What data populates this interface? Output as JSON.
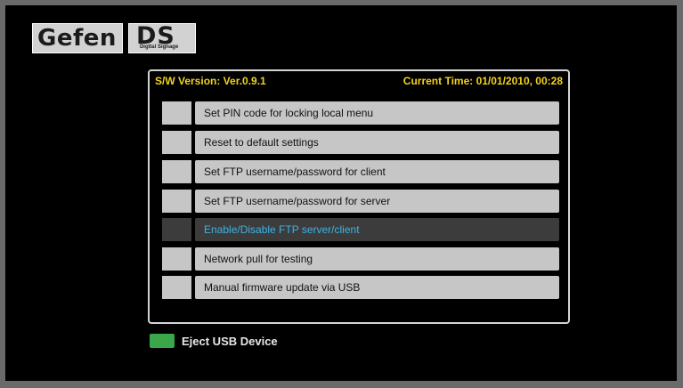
{
  "brand": {
    "name": "Gefen",
    "product": "DS",
    "product_subtitle": "Digital Signage"
  },
  "header": {
    "version": "S/W Version: Ver.0.9.1",
    "current_time": "Current Time: 01/01/2010, 00:28"
  },
  "menu": {
    "items": [
      {
        "label": "Set PIN code for locking local menu"
      },
      {
        "label": "Reset to default settings"
      },
      {
        "label": "Set FTP username/password for client"
      },
      {
        "label": "Set FTP username/password for server"
      },
      {
        "label": "Enable/Disable FTP server/client",
        "selected": true
      },
      {
        "label": "Network pull for testing"
      },
      {
        "label": "Manual firmware update via USB"
      }
    ]
  },
  "footer": {
    "eject_label": "Eject USB Device",
    "eject_key_color": "#3aa84a"
  },
  "colors": {
    "header_text": "#f2d21e",
    "selected_text": "#3cb4e6",
    "item_background": "#c6c6c6",
    "selected_background": "#3c3c3c"
  }
}
